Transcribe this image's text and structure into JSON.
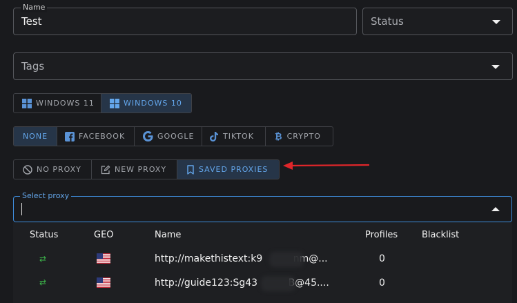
{
  "name_field": {
    "label": "Name",
    "value": "Test"
  },
  "status_field": {
    "placeholder": "Status"
  },
  "tags_field": {
    "placeholder": "Tags"
  },
  "os_options": [
    {
      "label": "WINDOWS 11",
      "icon": "windows-icon",
      "active": false
    },
    {
      "label": "WINDOWS 10",
      "icon": "windows-icon",
      "active": true
    }
  ],
  "platform_options": [
    {
      "label": "NONE",
      "icon": "",
      "active": true
    },
    {
      "label": "FACEBOOK",
      "icon": "facebook-icon",
      "active": false
    },
    {
      "label": "GOOGLE",
      "icon": "google-icon",
      "active": false
    },
    {
      "label": "TIKTOK",
      "icon": "tiktok-icon",
      "active": false
    },
    {
      "label": "CRYPTO",
      "icon": "bitcoin-icon",
      "active": false
    }
  ],
  "proxy_mode_options": [
    {
      "label": "NO PROXY",
      "icon": "no-entry-icon",
      "active": false
    },
    {
      "label": "NEW PROXY",
      "icon": "edit-icon",
      "active": false
    },
    {
      "label": "SAVED PROXIES",
      "icon": "bookmark-icon",
      "active": true
    }
  ],
  "select_proxy": {
    "label": "Select proxy"
  },
  "proxy_table": {
    "headers": {
      "status": "Status",
      "geo": "GEO",
      "name": "Name",
      "profiles": "Profiles",
      "blacklist": "Blacklist"
    },
    "rows": [
      {
        "status_icon": "swap-arrows-icon",
        "geo_icon": "us-flag-icon",
        "name": "http://makethistext:k9          nm@...",
        "profiles": "0",
        "blacklist": ""
      },
      {
        "status_icon": "swap-arrows-icon",
        "geo_icon": "us-flag-icon",
        "name": "http://guide123:Sg43          B@45....",
        "profiles": "0",
        "blacklist": ""
      }
    ]
  },
  "annotation_arrow": {
    "color": "#e0262a"
  },
  "colors": {
    "accent": "#3f8ede",
    "active_bg": "#263548",
    "active_text": "#64a7ec",
    "status_green": "#3cb44a"
  }
}
